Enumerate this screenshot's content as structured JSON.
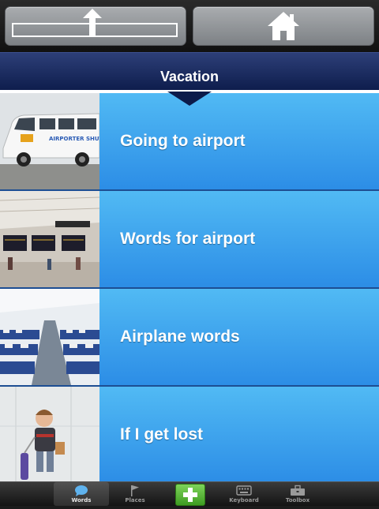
{
  "header": {
    "title": "Vacation"
  },
  "toolbar": {
    "up_icon": "up-arrow-icon",
    "home_icon": "home-icon"
  },
  "list": {
    "items": [
      {
        "label": "Going to airport",
        "thumb": "shuttle-van-photo",
        "thumb_text": "AIRPORTER SHUTTLE EXPRESS"
      },
      {
        "label": "Words for airport",
        "thumb": "airport-terminal-photo"
      },
      {
        "label": "Airplane words",
        "thumb": "airplane-cabin-photo"
      },
      {
        "label": "If I get lost",
        "thumb": "child-with-luggage-photo"
      }
    ]
  },
  "tabbar": {
    "tabs": [
      {
        "label": "Words",
        "icon": "speech-bubble-icon",
        "active": true
      },
      {
        "label": "Places",
        "icon": "flag-icon",
        "active": false
      },
      {
        "label": "",
        "icon": "plus-icon",
        "active": false
      },
      {
        "label": "Keyboard",
        "icon": "keyboard-icon",
        "active": false
      },
      {
        "label": "Toolbox",
        "icon": "toolbox-icon",
        "active": false
      }
    ]
  },
  "colors": {
    "row_top": "#51baf4",
    "row_bottom": "#2c8de6",
    "header_top": "#2d3f78",
    "header_bottom": "#0c1b4a",
    "add_green": "#5cbf3a"
  }
}
